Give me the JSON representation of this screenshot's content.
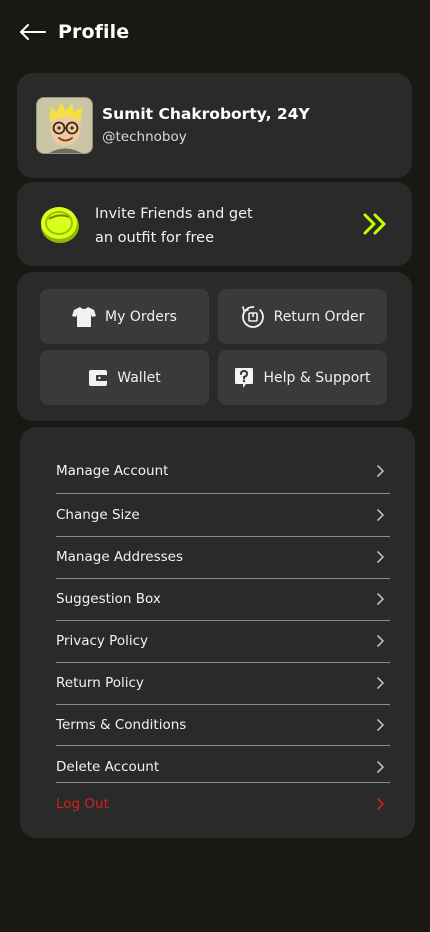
{
  "header": {
    "title": "Profile",
    "back_icon": "arrow-left-icon"
  },
  "profile": {
    "name": "Sumit Chakroborty, 24Y",
    "handle": "@technoboy",
    "avatar_icon": "memoji-avatar"
  },
  "invite": {
    "line1": "Invite Friends and get",
    "line2": "an outfit for free",
    "icon": "coin-icon",
    "arrow_icon": "double-chevron-right-icon",
    "accent": "#c6ff00"
  },
  "actions": [
    {
      "label": "My Orders",
      "icon": "tshirt-icon"
    },
    {
      "label": "Return Order",
      "icon": "return-icon"
    },
    {
      "label": "Wallet",
      "icon": "wallet-icon"
    },
    {
      "label": "Help & Support",
      "icon": "help-icon"
    }
  ],
  "menu": [
    {
      "label": "Manage Account"
    },
    {
      "label": "Change Size"
    },
    {
      "label": "Manage Addresses"
    },
    {
      "label": "Suggestion Box"
    },
    {
      "label": "Privacy Policy"
    },
    {
      "label": "Return Policy"
    },
    {
      "label": "Terms & Conditions"
    },
    {
      "label": "Delete Account"
    },
    {
      "label": "Log Out",
      "color": "#d61f1f"
    }
  ],
  "colors": {
    "background": "#191813",
    "card": "#2a2a2a",
    "button": "#3a3a3a",
    "danger": "#d61f1f"
  }
}
